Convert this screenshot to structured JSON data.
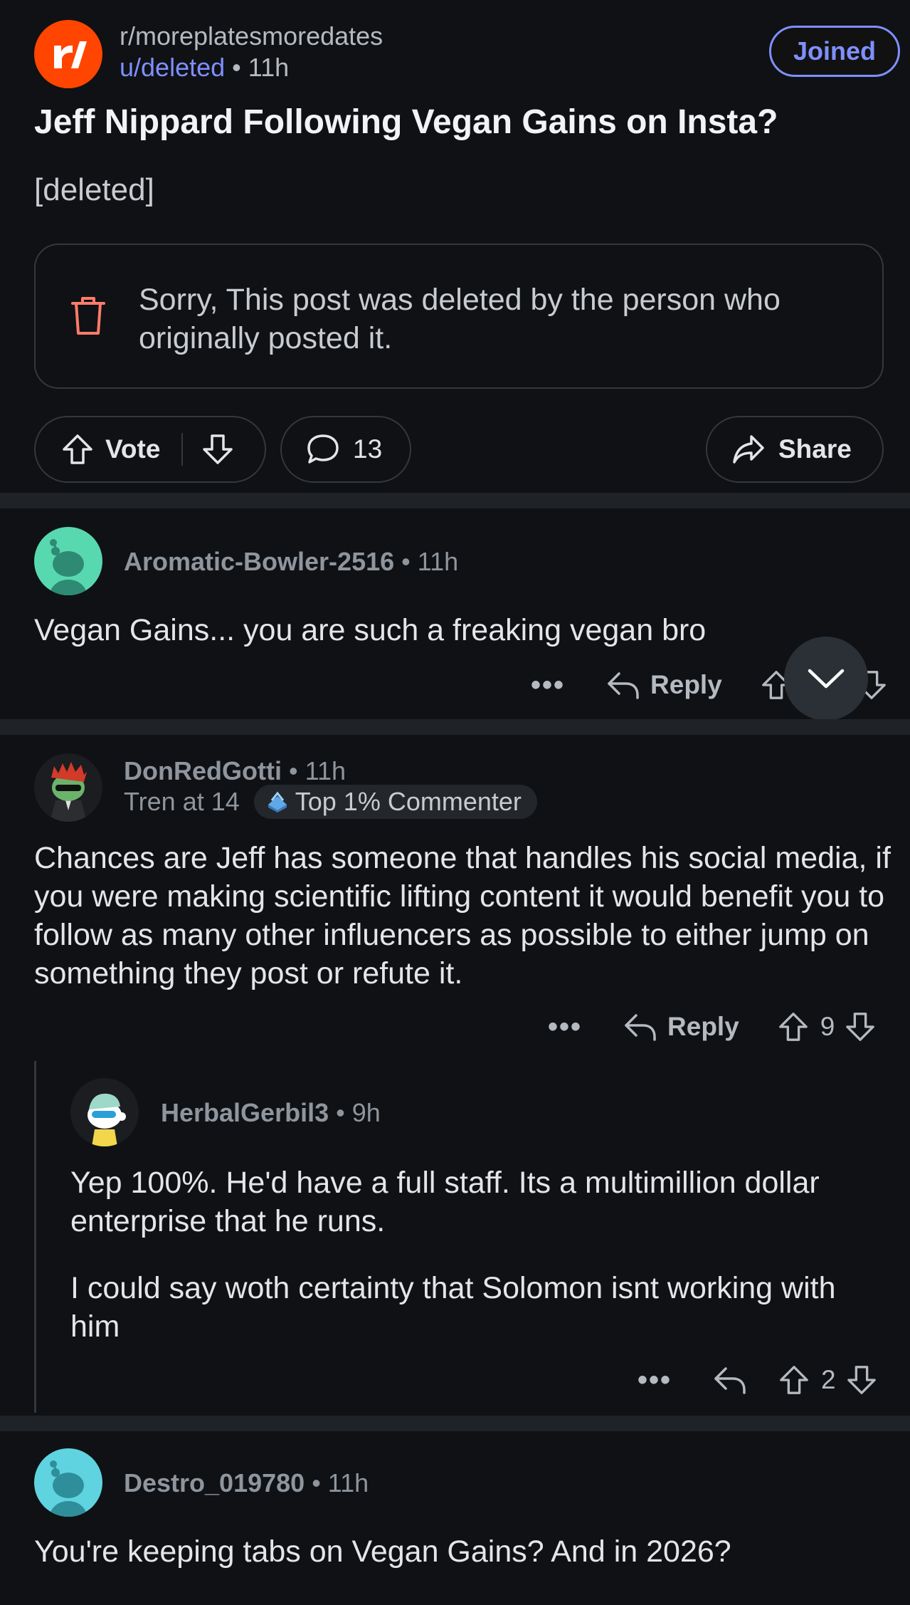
{
  "post": {
    "subreddit": "r/moreplatesmoredates",
    "author": "u/deleted",
    "separator": "•",
    "time": "11h",
    "joined_label": "Joined",
    "title": "Jeff Nippard Following Vegan Gains on Insta?",
    "body": "[deleted]",
    "deleted_message": "Sorry, This post was deleted by the person who originally posted it.",
    "vote_label": "Vote",
    "comment_count": "13",
    "share_label": "Share"
  },
  "comments": [
    {
      "author": "Aromatic-Bowler-2516",
      "time": "• 11h",
      "body": "Vegan Gains... you are such a freaking vegan bro",
      "more": "•••",
      "reply_label": "Reply"
    },
    {
      "author": "DonRedGotti",
      "time": "• 11h",
      "flair": "Tren at 14",
      "badge": "Top 1% Commenter",
      "body": "Chances are Jeff has someone that handles his social media, if you were making scientific lifting content it would benefit you to follow as many other influencers as possible to either jump on something they post or refute it.",
      "more": "•••",
      "reply_label": "Reply",
      "score": "9"
    },
    {
      "author": "HerbalGerbil3",
      "time": "• 9h",
      "body_p1": "Yep 100%. He'd have a full staff. Its a multimillion dollar enterprise that he runs.",
      "body_p2": "I could say woth certainty that Solomon isnt working with him",
      "more": "•••",
      "score": "2"
    },
    {
      "author": "Destro_019780",
      "time": "• 11h",
      "body": "You're keeping tabs on Vegan Gains? And in 2026?"
    }
  ],
  "colors": {
    "background": "#0f1114",
    "accent": "#7f8fff",
    "brand": "#ff4500",
    "trash": "#ff7b6b"
  }
}
